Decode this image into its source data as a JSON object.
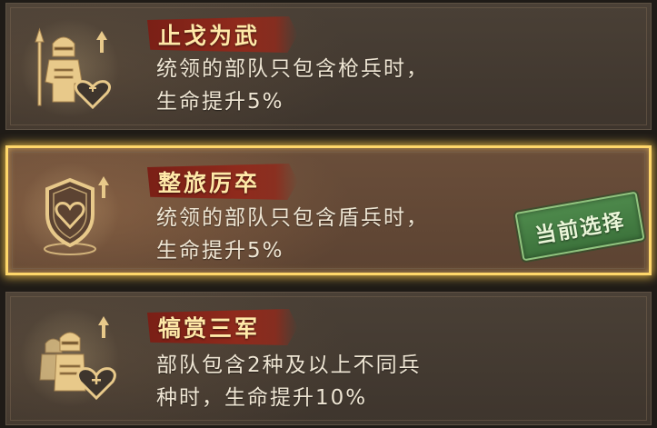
{
  "skills": [
    {
      "title": "止戈为武",
      "desc_lines": [
        "统领的部队只包含枪兵时，",
        "生命提升5%"
      ],
      "icon": "spearman-heal-icon",
      "selected": false
    },
    {
      "title": "整旅厉卒",
      "desc_lines": [
        "统领的部队只包含盾兵时，",
        "生命提升5%"
      ],
      "icon": "shield-heart-icon",
      "selected": true
    },
    {
      "title": "犒赏三军",
      "desc_lines": [
        "部队包含2种及以上不同兵",
        "种时，生命提升10%"
      ],
      "icon": "army-heal-icon",
      "selected": false
    }
  ],
  "badge": {
    "label": "当前选择"
  },
  "colors": {
    "gold": "#ffd76a",
    "ribbon": "#8f2a1c",
    "badge_green": "#4e8a4c",
    "icon_gold": "#e8c98a"
  }
}
